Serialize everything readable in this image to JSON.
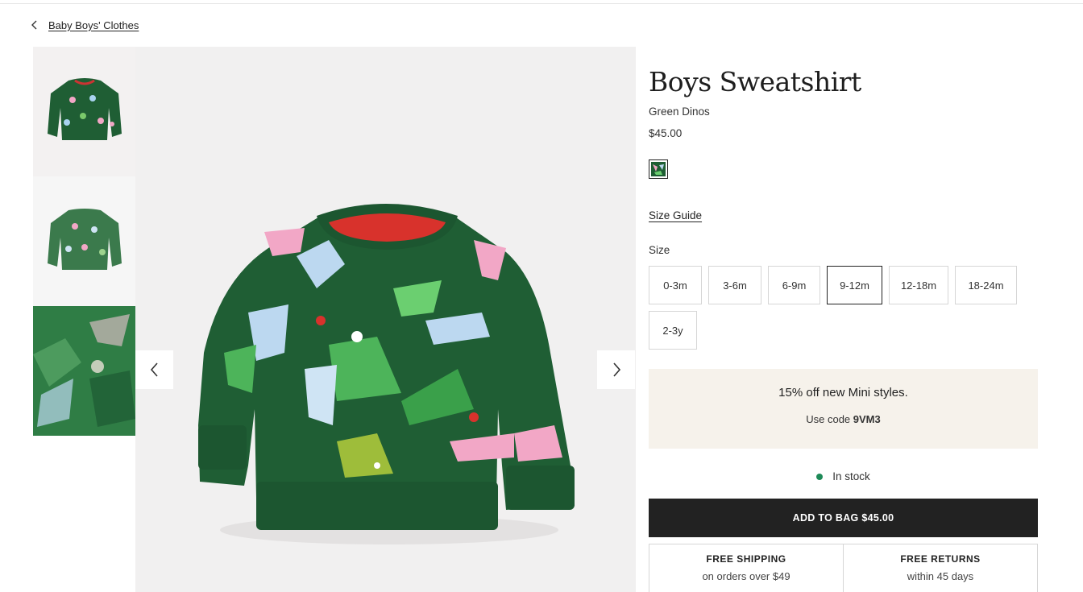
{
  "breadcrumb": {
    "back_label": "Baby Boys' Clothes"
  },
  "gallery": {
    "thumbnails": [
      {
        "label": "Front view"
      },
      {
        "label": "Back view"
      },
      {
        "label": "Fabric detail"
      }
    ],
    "prev_icon": "chevron-left-icon",
    "next_icon": "chevron-right-icon"
  },
  "product": {
    "title": "Boys Sweatshirt",
    "color_name": "Green Dinos",
    "price": "$45.00",
    "size_guide_label": "Size Guide",
    "size_label": "Size",
    "sizes": [
      "0-3m",
      "3-6m",
      "6-9m",
      "9-12m",
      "12-18m",
      "18-24m",
      "2-3y"
    ],
    "selected_size": "9-12m"
  },
  "promo": {
    "headline": "15% off new Mini styles.",
    "code_prefix": "Use code ",
    "code": "9VM3"
  },
  "stock": {
    "status": "In stock",
    "color": "#1e8a58"
  },
  "cart": {
    "add_label": "ADD TO BAG $45.00"
  },
  "perks": [
    {
      "title": "FREE SHIPPING",
      "subtitle": "on orders over $49"
    },
    {
      "title": "FREE RETURNS",
      "subtitle": "within 45 days"
    }
  ],
  "colors": {
    "sweatshirt_green": "#1f5e34",
    "button_dark": "#222222",
    "promo_bg": "#f6f2eb"
  }
}
